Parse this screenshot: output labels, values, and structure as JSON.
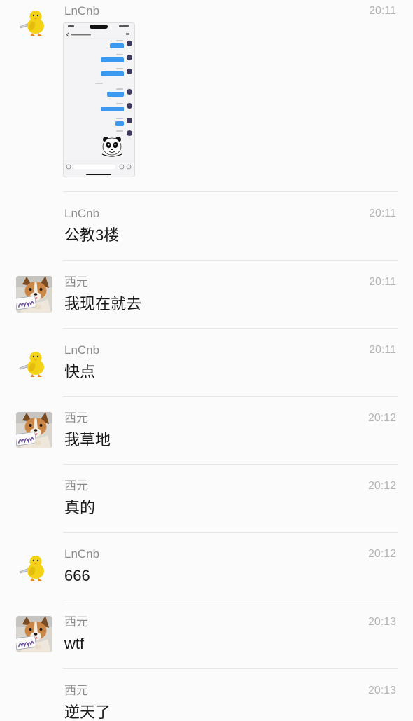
{
  "colors": {
    "background": "#fbfbfb",
    "name": "#8b8b8b",
    "time": "#b3b3b3",
    "text": "#1b1b1b",
    "separator": "#e6e6e6",
    "bubble": "#3b99f0"
  },
  "chat": {
    "messages": [
      {
        "sender": "LnCnb",
        "time": "20:11",
        "avatar": "duck-avatar"
      },
      {
        "sender": "LnCnb",
        "time": "20:11",
        "text": "公教3楼"
      },
      {
        "sender": "西元",
        "time": "20:11",
        "avatar": "dog-avatar",
        "text": "我现在就去"
      },
      {
        "sender": "LnCnb",
        "time": "20:11",
        "avatar": "duck-avatar",
        "text": "快点"
      },
      {
        "sender": "西元",
        "time": "20:12",
        "avatar": "dog-avatar",
        "text": "我草地"
      },
      {
        "sender": "西元",
        "time": "20:12",
        "text": "真的"
      },
      {
        "sender": "LnCnb",
        "time": "20:12",
        "avatar": "duck-avatar",
        "text": "666"
      },
      {
        "sender": "西元",
        "time": "20:13",
        "avatar": "dog-avatar",
        "text": "wtf"
      },
      {
        "sender": "西元",
        "time": "20:13",
        "text": "逆天了"
      }
    ]
  }
}
